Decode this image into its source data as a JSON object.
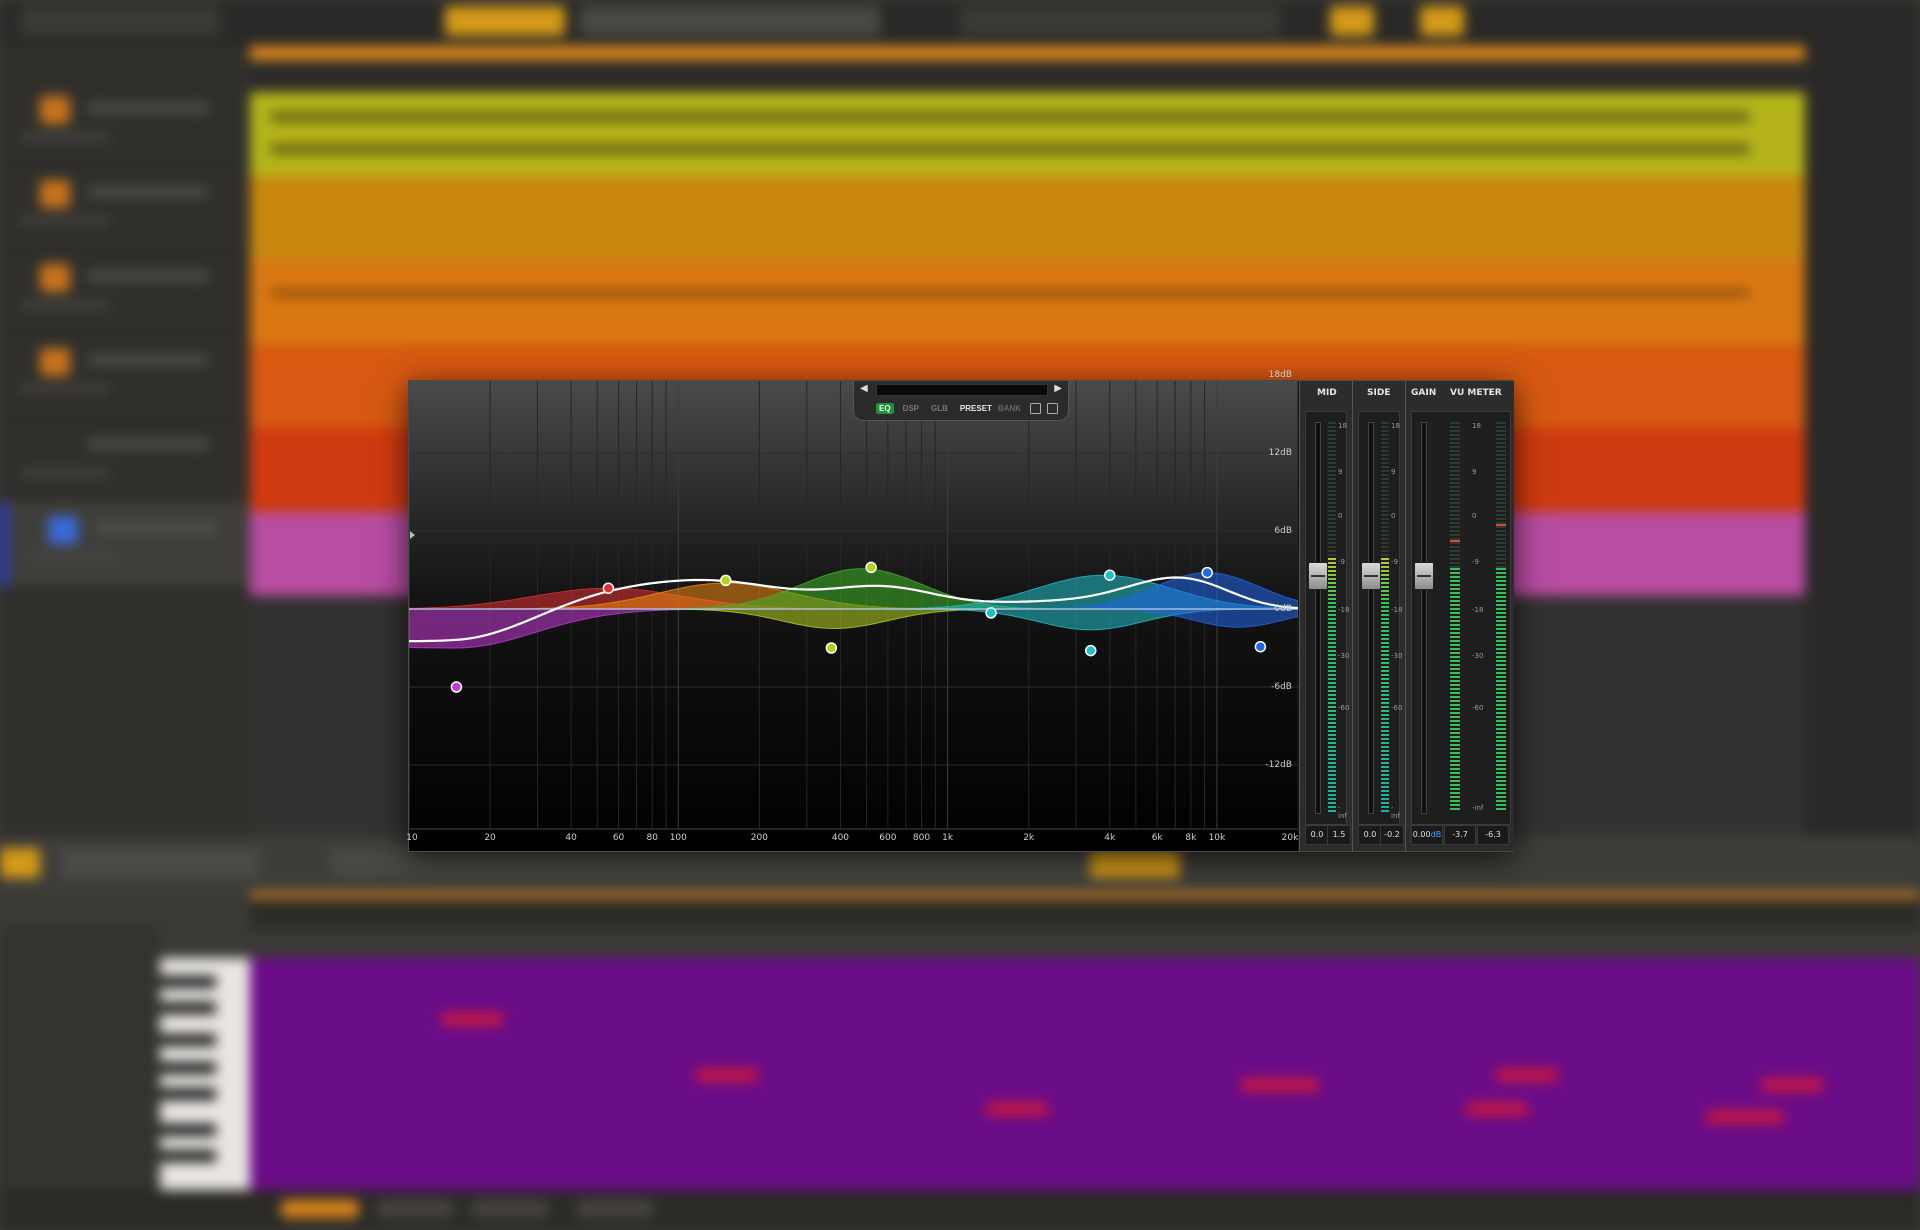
{
  "eq": {
    "preset_tabs": [
      "EQ",
      "DSP",
      "GLB",
      "PRESET",
      "BANK"
    ],
    "db_labels": [
      "18dB",
      "12dB",
      "6dB",
      "0dB",
      "-6dB",
      "-12dB"
    ],
    "freq_labels": [
      "10",
      "20",
      "40",
      "60",
      "80",
      "100",
      "200",
      "400",
      "600",
      "800",
      "1k",
      "2k",
      "4k",
      "6k",
      "8k",
      "10k",
      "20k"
    ],
    "band_colors": [
      "#c23ad6",
      "#e03131",
      "#f08a12",
      "#b5d022",
      "#3fb426",
      "#20c0c8",
      "#2066e8"
    ],
    "curve_color": "#ffffff"
  },
  "meters": {
    "mid": {
      "label": "MID",
      "values": [
        "0.0",
        "1.5"
      ]
    },
    "side": {
      "label": "SIDE",
      "values": [
        "0.0",
        "-0.2"
      ]
    },
    "gain": {
      "label": "GAIN"
    },
    "vu": {
      "label": "VU METER",
      "values": [
        "0.00",
        "-3.7",
        "-6.3"
      ],
      "gain_value_suffix": "dB"
    },
    "scale": [
      "18",
      "9",
      "0",
      "-9",
      "-18",
      "-30",
      "-60",
      "-inf"
    ],
    "mid_fader_db": 0.0,
    "side_fader_db": 0.0,
    "gain_fader_db": 0.0
  }
}
